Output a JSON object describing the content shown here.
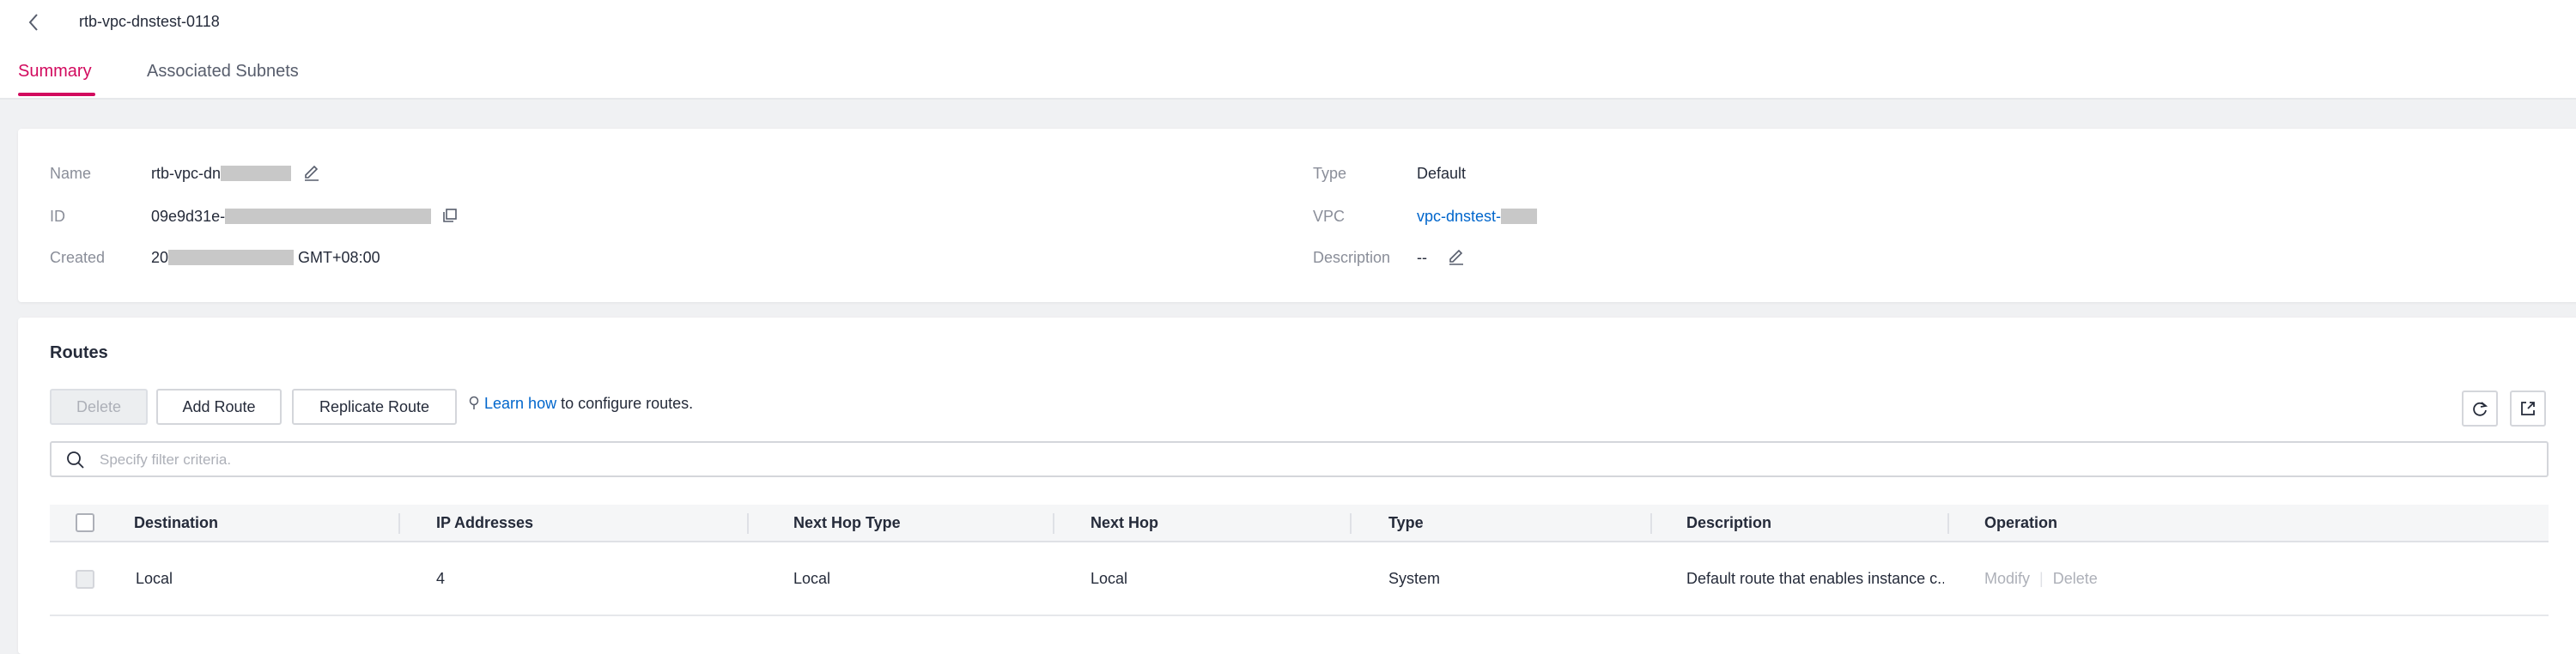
{
  "header": {
    "title": "rtb-vpc-dnstest-0118",
    "tabs": [
      {
        "label": "Summary",
        "active": true
      },
      {
        "label": "Associated Subnets",
        "active": false
      }
    ],
    "accent_color": "#d20a5e"
  },
  "summary": {
    "name_label": "Name",
    "name_value": "rtb-vpc-dn",
    "id_label": "ID",
    "id_value": "09e9d31e-",
    "created_label": "Created",
    "created_prefix": "20",
    "created_suffix": "GMT+08:00",
    "type_label": "Type",
    "type_value": "Default",
    "vpc_label": "VPC",
    "vpc_value": "vpc-dnstest-",
    "description_label": "Description",
    "description_value": "--"
  },
  "routes": {
    "title": "Routes",
    "buttons": {
      "delete": "Delete",
      "add_route": "Add Route",
      "replicate_route": "Replicate Route"
    },
    "learn_link": "Learn how",
    "learn_suffix": " to configure routes.",
    "search_placeholder": "Specify filter criteria.",
    "columns": [
      "Destination",
      "IP Addresses",
      "Next Hop Type",
      "Next Hop",
      "Type",
      "Description",
      "Operation"
    ],
    "rows": [
      {
        "destination": "Local",
        "ip_addresses": "4",
        "next_hop_type": "Local",
        "next_hop": "Local",
        "type": "System",
        "description": "Default route that enables instance c...",
        "operations": [
          "Modify",
          "Delete"
        ]
      }
    ]
  },
  "icons": {
    "back": "chevron-left-icon",
    "edit": "pencil-icon",
    "copy": "copy-icon",
    "refresh": "refresh-icon",
    "export": "export-icon",
    "search": "search-icon",
    "tip": "lightbulb-icon"
  }
}
